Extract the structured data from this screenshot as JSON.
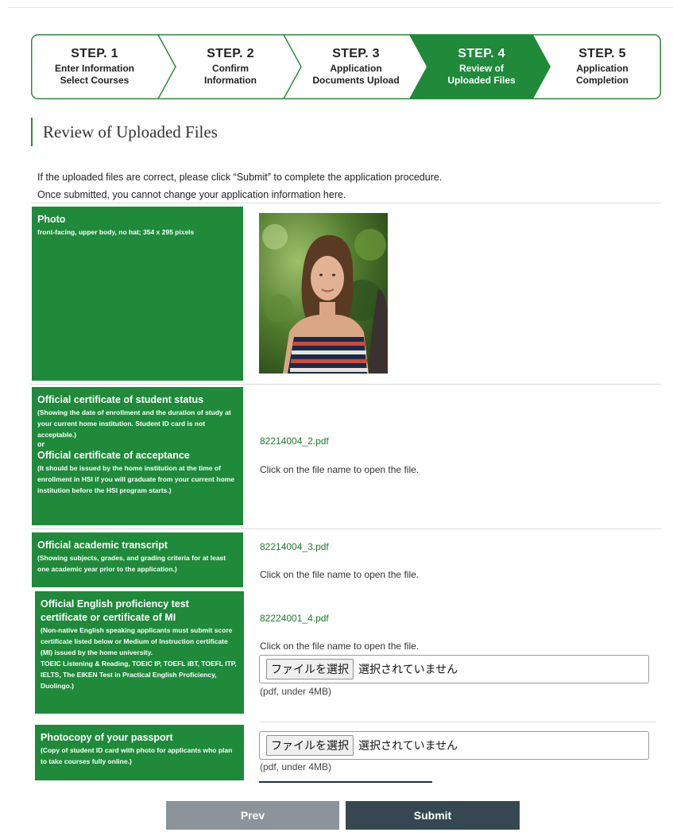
{
  "stepper": {
    "steps": [
      {
        "num": "STEP. 1",
        "label": "Enter Information\nSelect Courses"
      },
      {
        "num": "STEP. 2",
        "label": "Confirm\nInformation"
      },
      {
        "num": "STEP. 3",
        "label": "Application\nDocuments Upload"
      },
      {
        "num": "STEP. 4",
        "label": "Review of\nUploaded Files"
      },
      {
        "num": "STEP. 5",
        "label": "Application\nCompletion"
      }
    ],
    "active_index": 3,
    "accent_color": "#1e8a3a"
  },
  "page": {
    "title": "Review of Uploaded Files",
    "intro_line1": "If the uploaded files are correct, please click “Submit” to complete the application procedure.",
    "intro_line2": "Once submitted, you cannot change your application information here."
  },
  "rows": {
    "photo": {
      "title": "Photo",
      "desc": "front-facing, upper body, no hat; 354 x 295 pixels"
    },
    "status": {
      "title": "Official certificate of student status",
      "desc": "(Showing the date of enrollment and the duration of study at your current home institution. Student ID card is not acceptable.)",
      "or": "or",
      "title2": "Official certificate of acceptance",
      "desc2": "(It should be issued by the home institution at the time of enrollment in HSI if you will graduate from your current home institution before the HSI program starts.)",
      "file": "82214004_2.pdf",
      "hint": "Click on the file name to open the file."
    },
    "transcript": {
      "title": "Official academic transcript",
      "desc": "(Showing subjects, grades, and grading criteria for at least one academic year prior to the application.)",
      "file": "82214004_3.pdf",
      "hint": "Click on the file name to open the file."
    },
    "english": {
      "title": "Official English proficiency test certificate or certificate of MI",
      "desc": "(Non-native English speaking applicants must submit score certificate listed below or Medium of Instruction certificate (MI) issued by the home university.",
      "desc2": "TOEIC Listening & Reading, TOEIC IP, TOEFL iBT, TOEFL ITP, IELTS, The EIKEN Test in Practical English Proficiency, Duolingo.)",
      "file": "82224001_4.pdf",
      "hint": "Click on the file name to open the file.",
      "input_button": "ファイルを選択",
      "input_text": "選択されていません",
      "note": "(pdf, under 4MB)"
    },
    "passport": {
      "title": "Photocopy of your passport",
      "desc": "(Copy of student ID card with photo for applicants who plan to take courses fully online.)",
      "input_button": "ファイルを選択",
      "input_text": "選択されていません",
      "note": "(pdf, under 4MB)"
    }
  },
  "buttons": {
    "prev": "Prev",
    "submit": "Submit"
  }
}
